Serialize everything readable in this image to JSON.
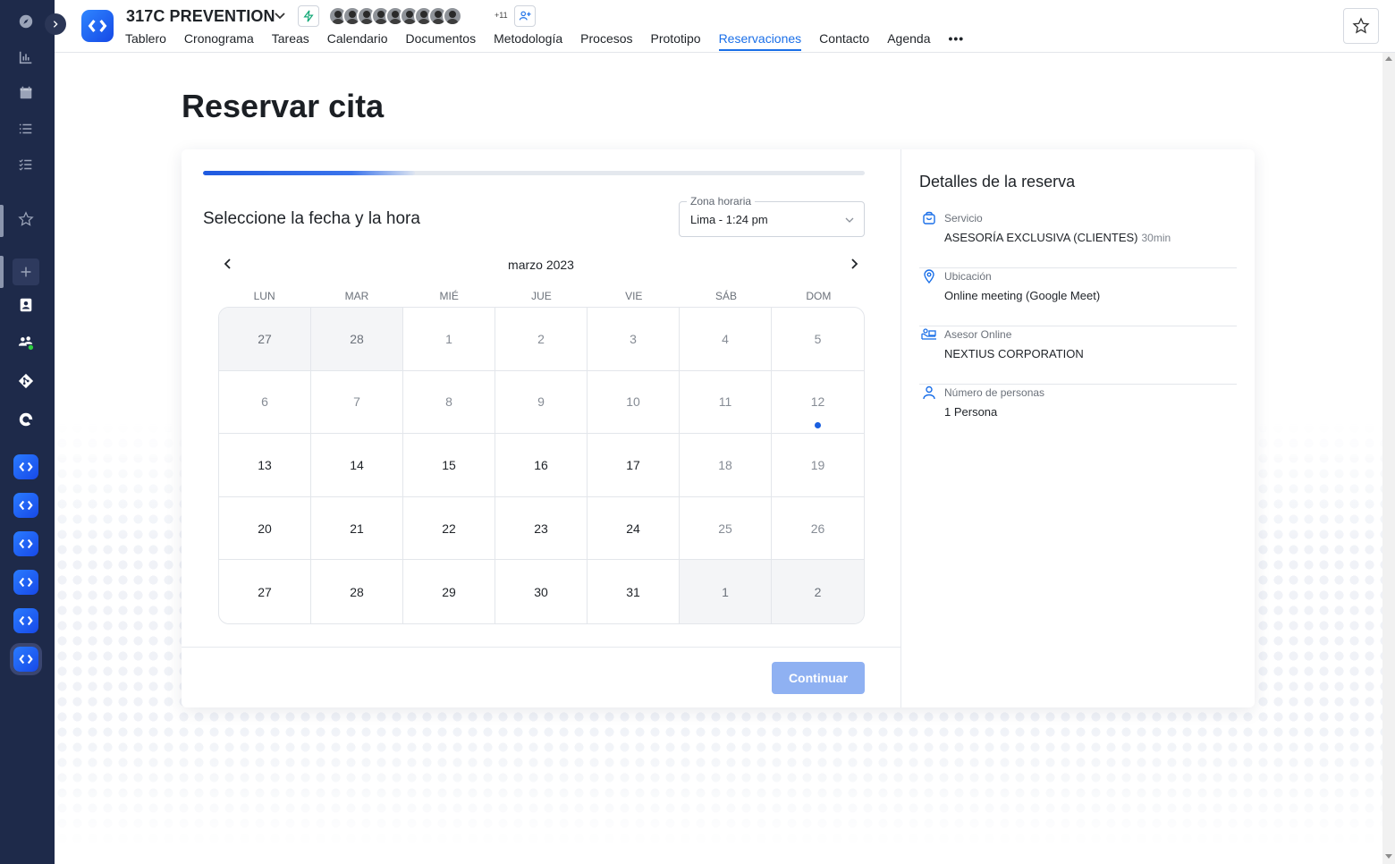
{
  "project": {
    "title": "317C PREVENTION",
    "extra_members": "+11"
  },
  "nav_tabs": [
    {
      "label": "Tablero"
    },
    {
      "label": "Cronograma"
    },
    {
      "label": "Tareas"
    },
    {
      "label": "Calendario"
    },
    {
      "label": "Documentos"
    },
    {
      "label": "Metodología"
    },
    {
      "label": "Procesos"
    },
    {
      "label": "Prototipo"
    },
    {
      "label": "Reservaciones",
      "active": true
    },
    {
      "label": "Contacto"
    },
    {
      "label": "Agenda"
    }
  ],
  "nav_more": "•••",
  "page": {
    "title": "Reservar cita"
  },
  "booking": {
    "progress_fraction": 0.32,
    "step_title": "Seleccione la fecha y la hora",
    "timezone": {
      "label": "Zona horaria",
      "value": "Lima - 1:24 pm"
    },
    "calendar": {
      "month_label": "marzo 2023",
      "weekdays": [
        "LUN",
        "MAR",
        "MIÉ",
        "JUE",
        "VIE",
        "SÁB",
        "DOM"
      ],
      "days": [
        {
          "d": "27",
          "s": "out"
        },
        {
          "d": "28",
          "s": "out"
        },
        {
          "d": "1",
          "s": "dis"
        },
        {
          "d": "2",
          "s": "dis"
        },
        {
          "d": "3",
          "s": "dis"
        },
        {
          "d": "4",
          "s": "dis"
        },
        {
          "d": "5",
          "s": "dis"
        },
        {
          "d": "6",
          "s": "dis"
        },
        {
          "d": "7",
          "s": "dis"
        },
        {
          "d": "8",
          "s": "dis"
        },
        {
          "d": "9",
          "s": "dis"
        },
        {
          "d": "10",
          "s": "dis"
        },
        {
          "d": "11",
          "s": "dis"
        },
        {
          "d": "12",
          "s": "dis",
          "today": true
        },
        {
          "d": "13",
          "s": "av"
        },
        {
          "d": "14",
          "s": "av"
        },
        {
          "d": "15",
          "s": "av"
        },
        {
          "d": "16",
          "s": "av"
        },
        {
          "d": "17",
          "s": "av"
        },
        {
          "d": "18",
          "s": "dis"
        },
        {
          "d": "19",
          "s": "dis"
        },
        {
          "d": "20",
          "s": "av"
        },
        {
          "d": "21",
          "s": "av"
        },
        {
          "d": "22",
          "s": "av"
        },
        {
          "d": "23",
          "s": "av"
        },
        {
          "d": "24",
          "s": "av"
        },
        {
          "d": "25",
          "s": "dis"
        },
        {
          "d": "26",
          "s": "dis"
        },
        {
          "d": "27",
          "s": "av"
        },
        {
          "d": "28",
          "s": "av"
        },
        {
          "d": "29",
          "s": "av"
        },
        {
          "d": "30",
          "s": "av"
        },
        {
          "d": "31",
          "s": "av"
        },
        {
          "d": "1",
          "s": "out"
        },
        {
          "d": "2",
          "s": "out"
        }
      ]
    },
    "continue_label": "Continuar"
  },
  "details": {
    "title": "Detalles de la reserva",
    "service": {
      "label": "Servicio",
      "value": "ASESORÍA EXCLUSIVA (CLIENTES)",
      "duration": "30min"
    },
    "location": {
      "label": "Ubicación",
      "value": "Online meeting (Google Meet)"
    },
    "advisor": {
      "label": "Asesor Online",
      "value": "NEXTIUS CORPORATION"
    },
    "people": {
      "label": "Número de personas",
      "value": "1 Persona"
    }
  },
  "colors": {
    "accent": "#1a6fe8",
    "rail_bg": "#1e2a4a",
    "button_disabled": "#8fb1f2"
  }
}
